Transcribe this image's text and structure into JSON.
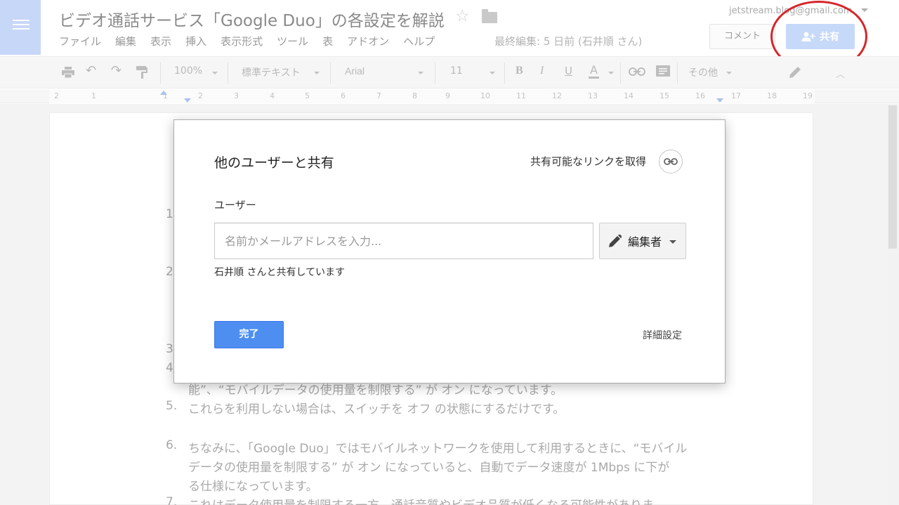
{
  "header": {
    "doc_title": "ビデオ通話サービス「Google Duo」の各設定を解説",
    "menu": [
      "ファイル",
      "編集",
      "表示",
      "挿入",
      "表示形式",
      "ツール",
      "表",
      "アドオン",
      "ヘルプ"
    ],
    "last_edit": "最終編集: 5 日前 (石井順 さん)",
    "account_email": "jetstream.blog@gmail.com",
    "comment_label": "コメント",
    "share_label": "共有"
  },
  "toolbar": {
    "zoom": "100%",
    "style": "標準テキスト",
    "font": "Arial",
    "size": "11",
    "more": "その他"
  },
  "ruler": {
    "labels": [
      "2",
      "1",
      "1",
      "2",
      "3",
      "4",
      "5",
      "6",
      "7",
      "8",
      "9",
      "10",
      "11",
      "12",
      "13",
      "14",
      "15",
      "16",
      "17",
      "18",
      "19"
    ]
  },
  "document": {
    "lines": [
      "1",
      "2",
      "3",
      "4",
      "能”、“モバイルデータの使用量を制限する” が オン になっています。",
      "5.",
      "これらを利用しない場合は、スイッチを オフ の状態にするだけです。",
      "6.",
      "ちなみに、「Google Duo」ではモバイルネットワークを使用して利用するときに、“モバイル",
      "データの使用量を制限する” が オン になっていると、自動でデータ速度が 1Mbps に下が",
      "る仕様になっています。",
      "7.",
      "これはデータ使用量を制限する一方、通話音質やビデオ品質が低くなる可能性がありま"
    ]
  },
  "dialog": {
    "title": "他のユーザーと共有",
    "get_link": "共有可能なリンクを取得",
    "users_label": "ユーザー",
    "input_placeholder": "名前かメールアドレスを入力...",
    "input_value": "",
    "role": "編集者",
    "shared_with": "石井順 さんと共有しています",
    "done": "完了",
    "advanced": "詳細設定"
  },
  "colors": {
    "accent_blue": "#4d8ef0",
    "annotation_red": "#d6262b"
  }
}
